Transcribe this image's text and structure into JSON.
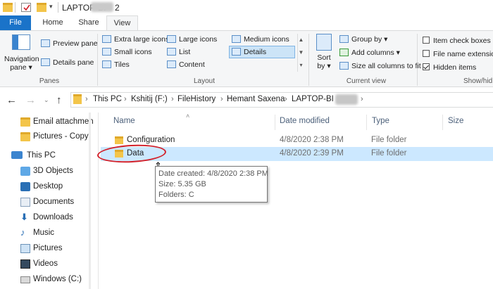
{
  "window": {
    "title_visible": "LAPTOP-BI",
    "title_suffix": "2"
  },
  "ribbon_tabs": [
    "File",
    "Home",
    "Share",
    "View"
  ],
  "ribbon": {
    "panes": {
      "navigation_pane_line1": "Navigation",
      "navigation_pane_line2": "pane",
      "preview_pane": "Preview pane",
      "details_pane": "Details pane",
      "label": "Panes"
    },
    "layout": {
      "extra_large_icons": "Extra large icons",
      "large_icons": "Large icons",
      "medium_icons": "Medium icons",
      "small_icons": "Small icons",
      "list": "List",
      "details": "Details",
      "tiles": "Tiles",
      "content": "Content",
      "label": "Layout"
    },
    "current_view": {
      "sort_by_line1": "Sort",
      "sort_by_line2": "by",
      "group_by": "Group by",
      "add_columns": "Add columns",
      "size_all_columns": "Size all columns to fit",
      "label": "Current view"
    },
    "show_hide": {
      "item_check_boxes": "Item check boxes",
      "file_name_extensions": "File name extension",
      "hidden_items": "Hidden items",
      "label": "Show/hid",
      "item_check_boxes_checked": false,
      "file_name_extensions_checked": false,
      "hidden_items_checked": true
    }
  },
  "address_bar": {
    "crumbs": [
      "This PC",
      "Kshitij (F:)",
      "FileHistory",
      "Hemant Saxena",
      "LAPTOP-BI"
    ]
  },
  "nav_pane": {
    "items": [
      {
        "label": "Email attachmen",
        "icon": "folder-icon"
      },
      {
        "label": "Pictures - Copy",
        "icon": "folder-icon"
      },
      {
        "label": "This PC",
        "icon": "computer-icon"
      },
      {
        "label": "3D Objects",
        "icon": "cube-icon"
      },
      {
        "label": "Desktop",
        "icon": "desktop-icon"
      },
      {
        "label": "Documents",
        "icon": "documents-icon"
      },
      {
        "label": "Downloads",
        "icon": "download-icon"
      },
      {
        "label": "Music",
        "icon": "music-icon"
      },
      {
        "label": "Pictures",
        "icon": "pictures-icon"
      },
      {
        "label": "Videos",
        "icon": "videos-icon"
      },
      {
        "label": "Windows (C:)",
        "icon": "drive-icon"
      }
    ]
  },
  "columns": [
    "Name",
    "Date modified",
    "Type",
    "Size"
  ],
  "rows": [
    {
      "name": "Configuration",
      "date": "4/8/2020 2:38 PM",
      "type": "File folder",
      "size": ""
    },
    {
      "name": "Data",
      "date": "4/8/2020 2:39 PM",
      "type": "File folder",
      "size": ""
    }
  ],
  "tooltip": {
    "date_created": "Date created: 4/8/2020 2:38 PM",
    "size": "Size: 5.35 GB",
    "folders": "Folders: C"
  },
  "colors": {
    "accent": "#1a73c9",
    "selection": "#cce8ff",
    "annotation": "#d2202a"
  }
}
